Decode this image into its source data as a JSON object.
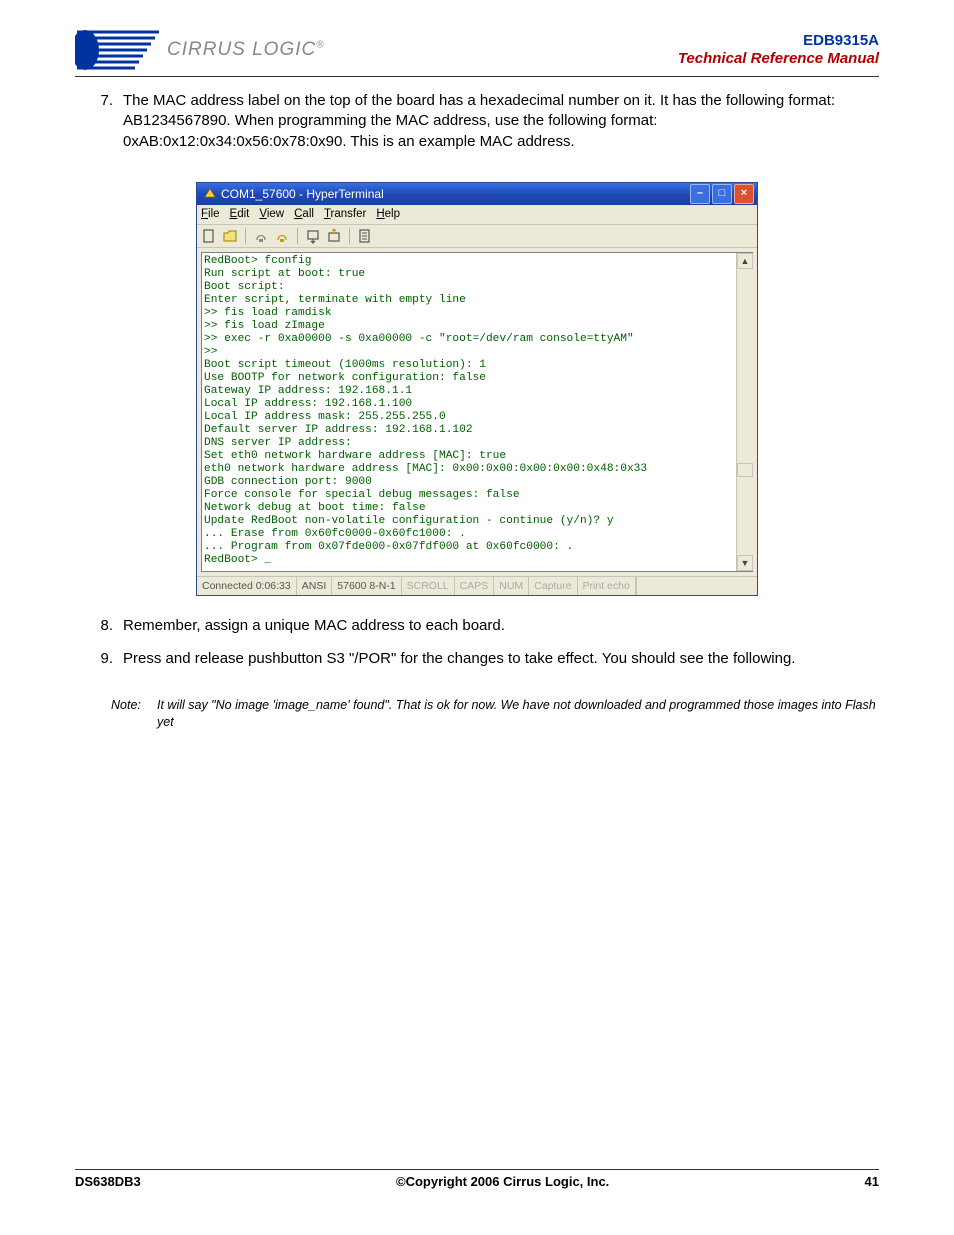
{
  "header": {
    "logo_text": "CIRRUS LOGIC",
    "model": "EDB9315A",
    "subtitle": "Technical Reference Manual"
  },
  "items": [
    {
      "num": "7.",
      "text": "The MAC address label on the top of the board has a hexadecimal number on it. It has the following format: AB1234567890. When programming the MAC address, use the following format: 0xAB:0x12:0x34:0x56:0x78:0x90. This is an example MAC address."
    },
    {
      "num": "8.",
      "text": "Remember, assign a unique MAC address to each board."
    },
    {
      "num": "9.",
      "text": "Press and release pushbutton S3 \"/POR\" for the changes to take effect. You should see the following."
    }
  ],
  "note": {
    "label": "Note:",
    "text": "It will say \"No image 'image_name' found\". That is ok for now. We have not downloaded and programmed those images into Flash yet"
  },
  "hyperterminal": {
    "title": "COM1_57600 - HyperTerminal",
    "menus": [
      "File",
      "Edit",
      "View",
      "Call",
      "Transfer",
      "Help"
    ],
    "terminal_text": "RedBoot> fconfig\nRun script at boot: true\nBoot script:\nEnter script, terminate with empty line\n>> fis load ramdisk\n>> fis load zImage\n>> exec -r 0xa00000 -s 0xa00000 -c \"root=/dev/ram console=ttyAM\"\n>>\nBoot script timeout (1000ms resolution): 1\nUse BOOTP for network configuration: false\nGateway IP address: 192.168.1.1\nLocal IP address: 192.168.1.100\nLocal IP address mask: 255.255.255.0\nDefault server IP address: 192.168.1.102\nDNS server IP address:\nSet eth0 network hardware address [MAC]: true\neth0 network hardware address [MAC]: 0x00:0x00:0x00:0x00:0x48:0x33\nGDB connection port: 9000\nForce console for special debug messages: false\nNetwork debug at boot time: false\nUpdate RedBoot non-volatile configuration - continue (y/n)? y\n... Erase from 0x60fc0000-0x60fc1000: .\n... Program from 0x07fde000-0x07fdf000 at 0x60fc0000: .\nRedBoot> _",
    "status": {
      "connected": "Connected 0:06:33",
      "emulation": "ANSI",
      "settings": "57600 8-N-1",
      "scroll": "SCROLL",
      "caps": "CAPS",
      "num": "NUM",
      "capture": "Capture",
      "printecho": "Print echo"
    }
  },
  "footer": {
    "left": "DS638DB3",
    "center": "©Copyright 2006 Cirrus Logic, Inc.",
    "right": "41"
  }
}
